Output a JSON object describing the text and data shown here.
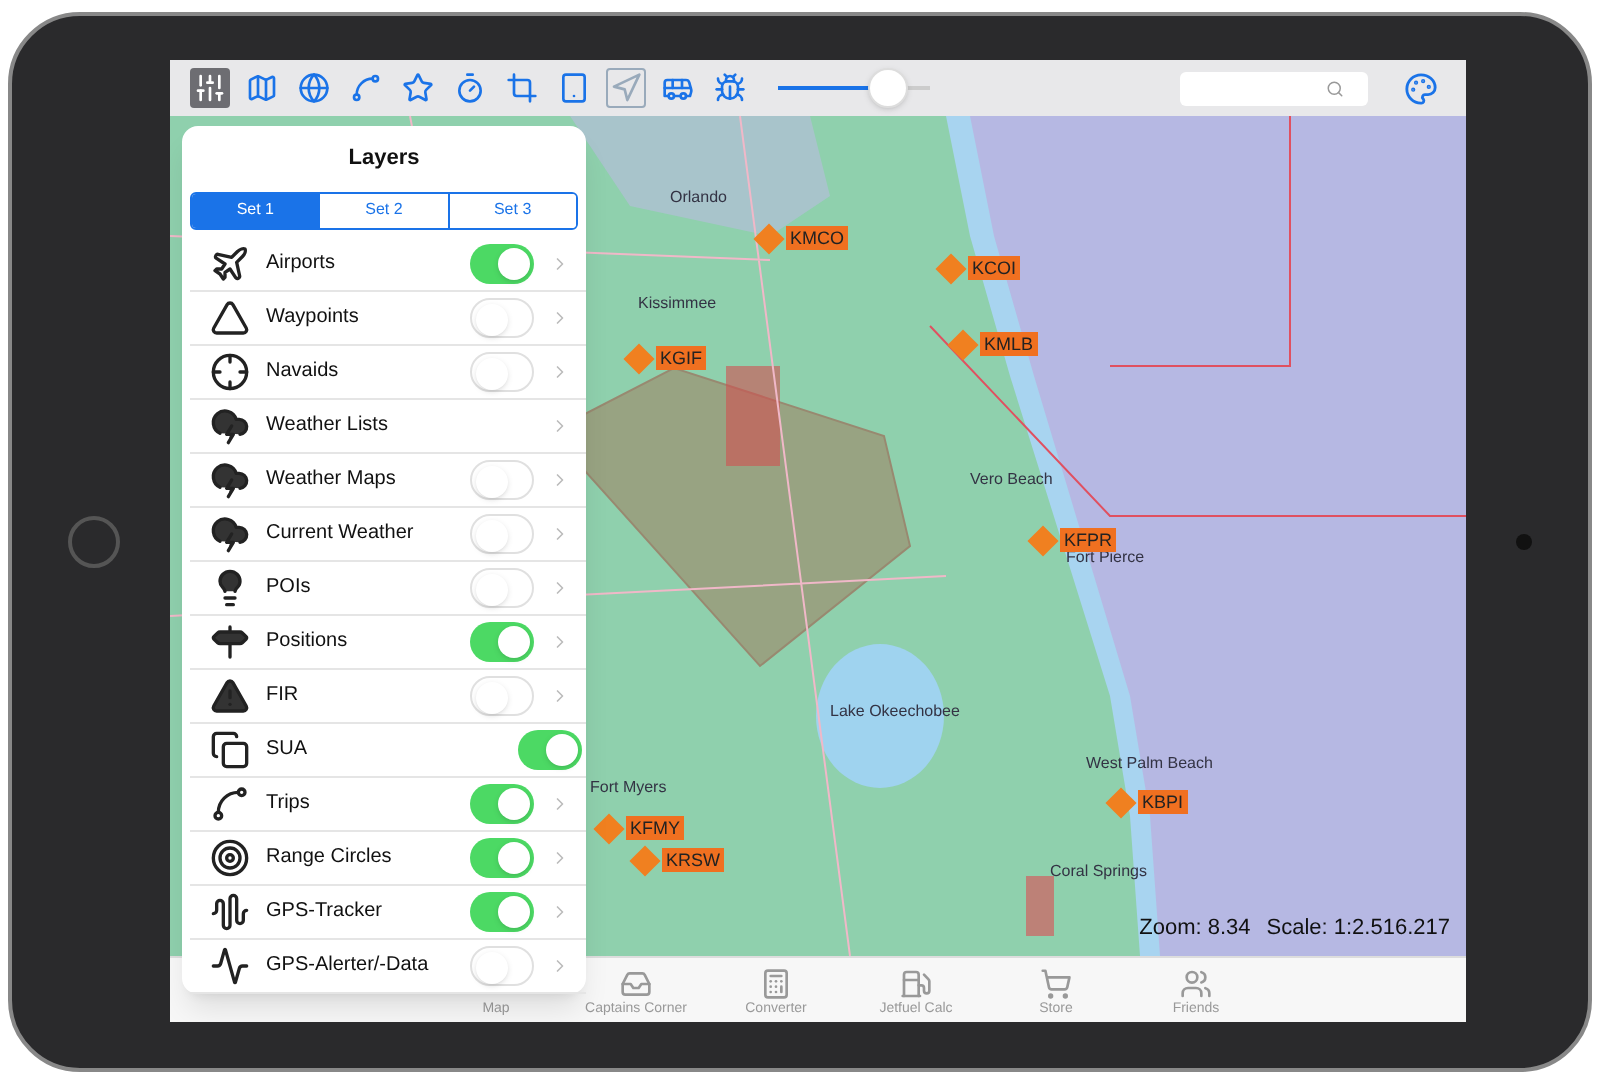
{
  "toolbar": {
    "slider": {
      "level": 0.73
    }
  },
  "layers": {
    "title": "Layers",
    "sets": [
      {
        "label": "Set 1",
        "selected": true
      },
      {
        "label": "Set 2",
        "selected": false
      },
      {
        "label": "Set 3",
        "selected": false
      }
    ],
    "items": [
      {
        "label": "Airports",
        "kind": "toggle",
        "on": true
      },
      {
        "label": "Waypoints",
        "kind": "toggle",
        "on": false
      },
      {
        "label": "Navaids",
        "kind": "toggle",
        "on": false
      },
      {
        "label": "Weather Lists",
        "kind": "link"
      },
      {
        "label": "Weather Maps",
        "kind": "toggle",
        "on": false
      },
      {
        "label": "Current Weather",
        "kind": "toggle",
        "on": false
      },
      {
        "label": "POIs",
        "kind": "toggle",
        "on": false
      },
      {
        "label": "Positions",
        "kind": "toggle",
        "on": true
      },
      {
        "label": "FIR",
        "kind": "toggle",
        "on": false
      },
      {
        "label": "SUA",
        "kind": "switch",
        "on": true
      },
      {
        "label": "Trips",
        "kind": "toggle",
        "on": true
      },
      {
        "label": "Range Circles",
        "kind": "toggle",
        "on": true
      },
      {
        "label": "GPS-Tracker",
        "kind": "toggle",
        "on": true
      },
      {
        "label": "GPS-Alerter/-Data",
        "kind": "toggle",
        "on": false
      }
    ]
  },
  "map": {
    "airports": [
      "KMCO",
      "KCOI",
      "KMLB",
      "KGIF",
      "KFPR",
      "KBPI",
      "KFMY",
      "KRSW"
    ],
    "places": [
      "Orlando",
      "Kissimmee",
      "Vero Beach",
      "Fort Pierce",
      "Lake Okeechobee",
      "West Palm Beach",
      "Fort Myers",
      "Coral Springs"
    ],
    "zoom": "Zoom: 8.34",
    "scale": "Scale: 1:2.516.217"
  },
  "tab_bar": [
    {
      "label": "Map"
    },
    {
      "label": "Captains Corner"
    },
    {
      "label": "Converter"
    },
    {
      "label": "Jetfuel Calc"
    },
    {
      "label": "Store"
    },
    {
      "label": "Friends"
    }
  ]
}
